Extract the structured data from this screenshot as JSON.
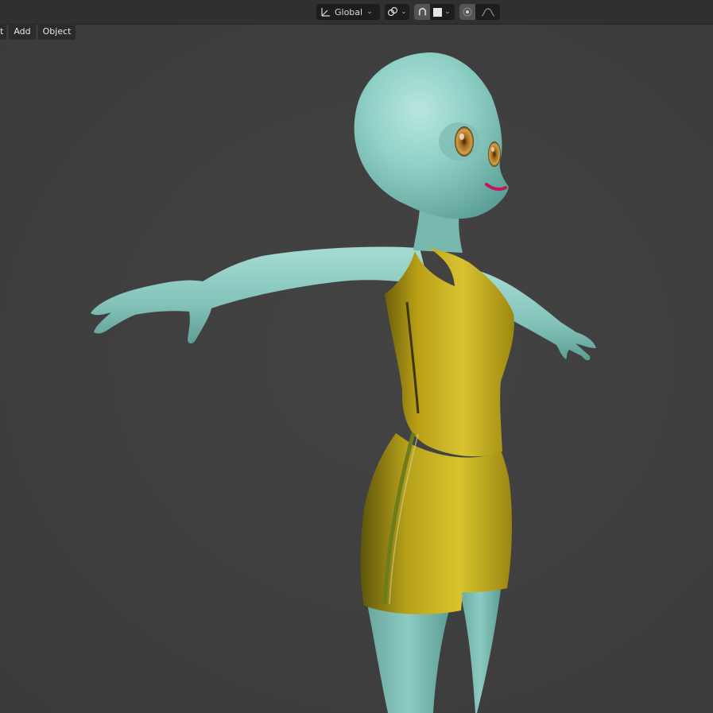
{
  "header": {
    "orientation_label": "Global",
    "icons": {
      "orientation": "transform-orientation-icon",
      "pivot": "transform-pivot-icon",
      "snap": "snap-magnet-icon",
      "snap_target": "snap-target-square-icon",
      "proportional": "proportional-editing-icon",
      "falloff": "falloff-curve-icon",
      "dropdown": "chevron-down-icon"
    }
  },
  "menu": {
    "items": [
      "t",
      "Add",
      "Object"
    ]
  },
  "scene": {
    "subject": "character-model",
    "colors": {
      "background": "#3d3d3d",
      "skin": "#7fc4bb",
      "outfit": "#c9b21a",
      "eye": "#c08b3a",
      "mouth": "#c2185b"
    }
  }
}
